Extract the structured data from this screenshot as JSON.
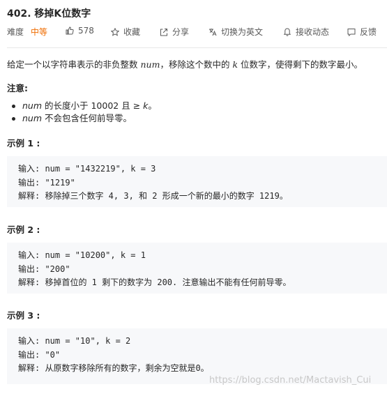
{
  "problem": {
    "title": "402. 移掉K位数字"
  },
  "toolbar": {
    "difficulty_label": "难度",
    "difficulty_value": "中等",
    "likes": "578",
    "favorite": "收藏",
    "share": "分享",
    "switch_lang": "切换为英文",
    "notify": "接收动态",
    "feedback": "反馈"
  },
  "description": {
    "p1": "给定一个以字符串表示的非负整数 ",
    "var_num": "num",
    "p2": "，移除这个数中的 ",
    "var_k": "k",
    "p3": " 位数字，使得剩下的数字最小。"
  },
  "notes": {
    "heading": "注意:",
    "n1_var": "num",
    "n1_text": " 的长度小于 10002 且 ≥ ",
    "n1_k": "k",
    "n1_end": "。",
    "n2_var": "num",
    "n2_text": " 不会包含任何前导零。"
  },
  "examples": [
    {
      "heading": "示例 1 :",
      "input": "输入: num = \"1432219\", k = 3",
      "output": "输出: \"1219\"",
      "explanation": "解释: 移除掉三个数字 4, 3, 和 2 形成一个新的最小的数字 1219。"
    },
    {
      "heading": "示例 2 :",
      "input": "输入: num = \"10200\", k = 1",
      "output": "输出: \"200\"",
      "explanation": "解释: 移掉首位的 1 剩下的数字为 200. 注意输出不能有任何前导零。"
    },
    {
      "heading": "示例 3 :",
      "input": "输入: num = \"10\", k = 2",
      "output": "输出: \"0\"",
      "explanation": "解释: 从原数字移除所有的数字，剩余为空就是0。"
    }
  ],
  "watermark": "https://blog.csdn.net/Mactavish_Cui"
}
